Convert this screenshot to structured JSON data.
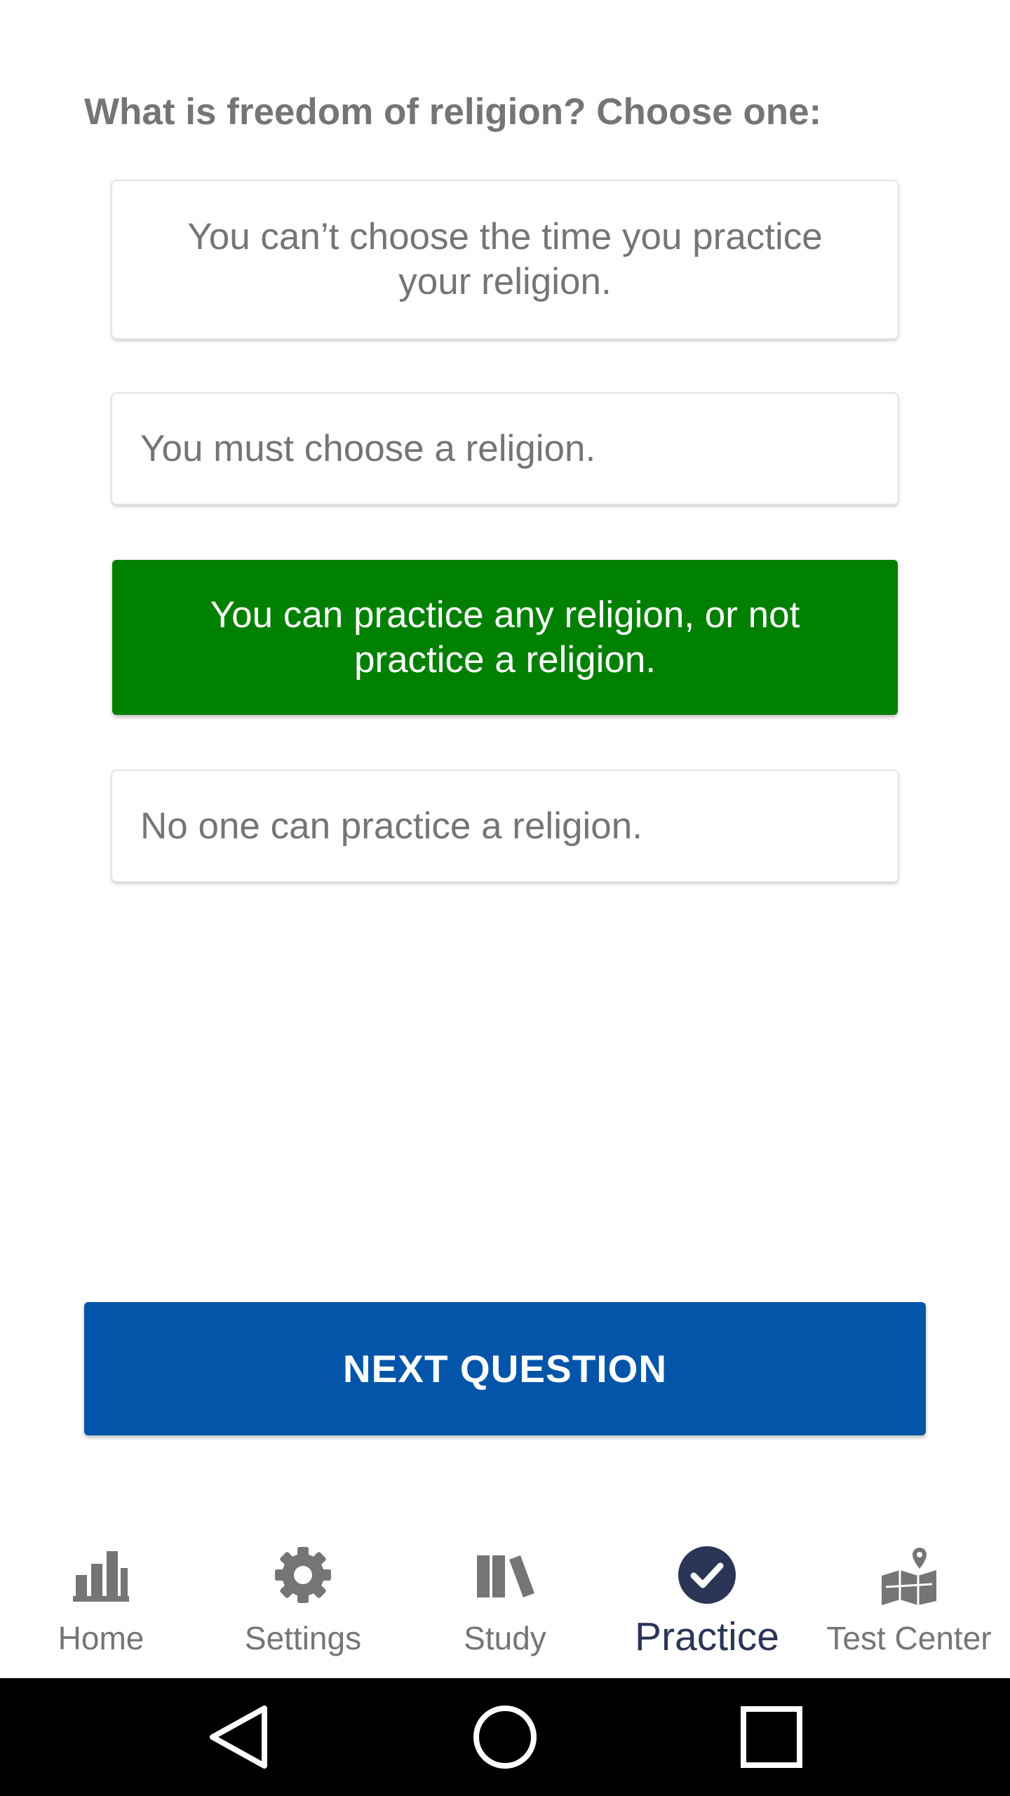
{
  "question": "What is freedom of religion? Choose one:",
  "answers": [
    {
      "text": "You can’t choose the time you practice your religion.",
      "state": "default"
    },
    {
      "text": "You must choose a religion.",
      "state": "default"
    },
    {
      "text": "You can practice any religion, or not practice a religion.",
      "state": "correct"
    },
    {
      "text": "No one can practice a religion.",
      "state": "default"
    }
  ],
  "next_button": "NEXT QUESTION",
  "nav": {
    "items": [
      {
        "label": "Home",
        "icon": "bar-chart-icon"
      },
      {
        "label": "Settings",
        "icon": "gear-icon"
      },
      {
        "label": "Study",
        "icon": "books-icon"
      },
      {
        "label": "Practice",
        "icon": "check-circle-icon",
        "active": true
      },
      {
        "label": "Test Center",
        "icon": "map-pin-icon"
      }
    ]
  },
  "colors": {
    "correct": "#008000",
    "primary": "#0255a8",
    "active_nav": "#2b3656",
    "muted_text": "#757575"
  }
}
